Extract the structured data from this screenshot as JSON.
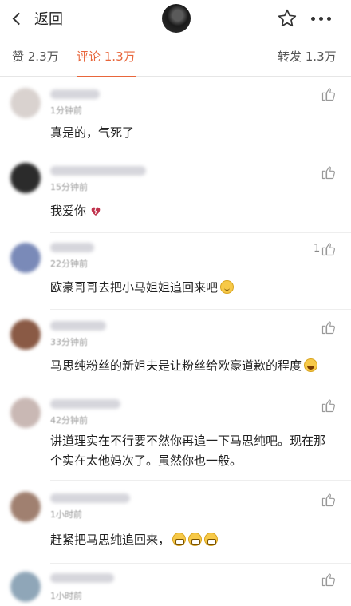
{
  "header": {
    "back_label": "返回"
  },
  "tabs": {
    "likes": "赞 2.3万",
    "comments": "评论 1.3万",
    "reposts": "转发 1.3万"
  },
  "comments": [
    {
      "time": "1分钟前",
      "text": "真是的，气死了",
      "like_count": "",
      "avatar_color": "#d9d2cf",
      "name_width": "62"
    },
    {
      "time": "15分钟前",
      "text": "我爱你",
      "emoji": "broken-heart-icon",
      "like_count": "",
      "avatar_color": "#2b2b2b",
      "name_width": "120"
    },
    {
      "time": "22分钟前",
      "text": "欧豪哥哥去把小马姐姐追回来吧",
      "emoji": "smile-icon",
      "like_count": "1",
      "avatar_color": "#7a8ab8",
      "name_width": "55"
    },
    {
      "time": "33分钟前",
      "text": "马思纯粉丝的新姐夫是让粉丝给欧豪道歉的程度",
      "emoji": "laugh-icon",
      "like_count": "",
      "avatar_color": "#8a5a45",
      "name_width": "70"
    },
    {
      "time": "42分钟前",
      "text": "讲道理实在不行要不然你再追一下马思纯吧。现在那个实在太他妈次了。虽然你也一般。",
      "like_count": "",
      "avatar_color": "#c9b8b4",
      "name_width": "88"
    },
    {
      "time": "1小时前",
      "text": "赶紧把马思纯追回来，",
      "emoji": "grin-icon-x3",
      "like_count": "",
      "avatar_color": "#a08070",
      "name_width": "100"
    },
    {
      "time": "1小时前",
      "text": "",
      "like_count": "",
      "avatar_color": "#8fa6b8",
      "name_width": "80"
    }
  ]
}
